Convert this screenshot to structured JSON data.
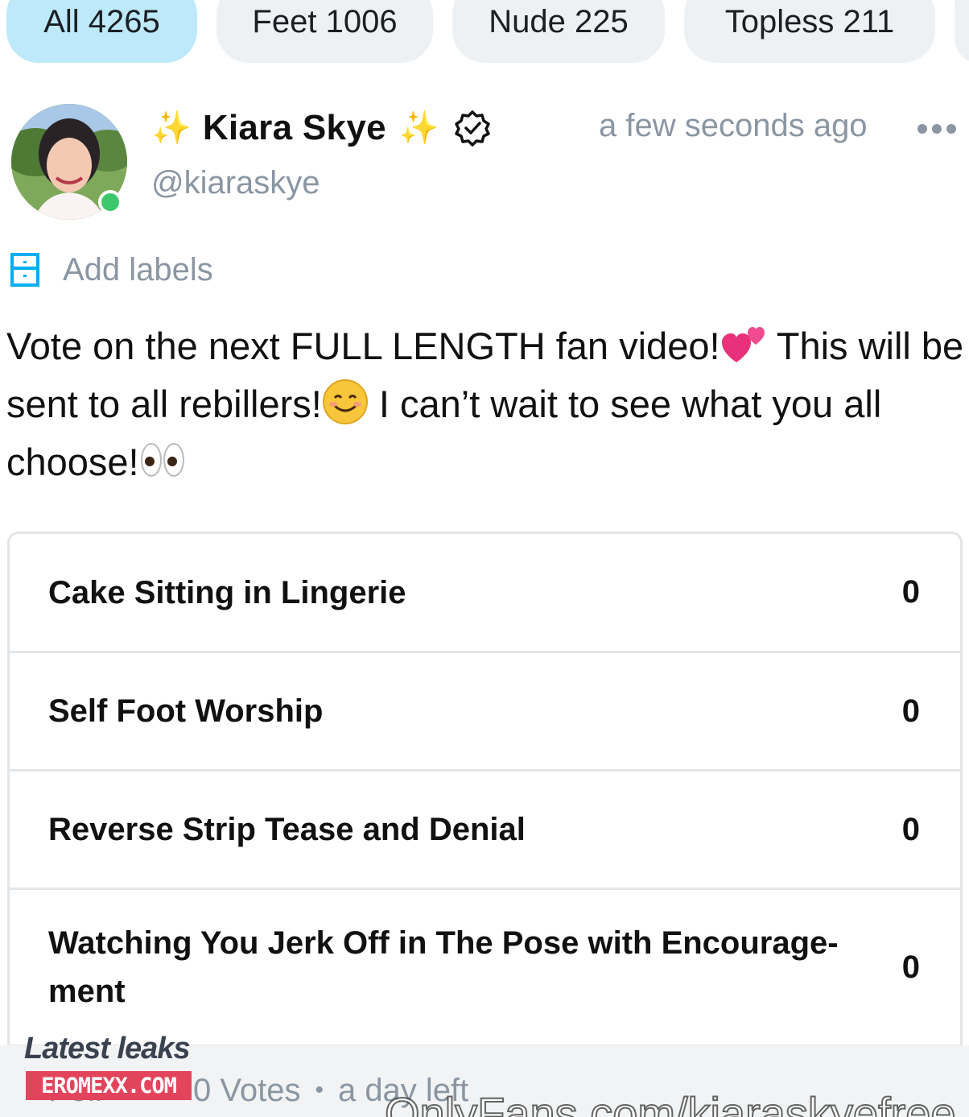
{
  "filters": [
    {
      "label": "All 4265",
      "active": true
    },
    {
      "label": "Feet 1006",
      "active": false
    },
    {
      "label": "Nude 225",
      "active": false
    },
    {
      "label": "Topless 211",
      "active": false
    }
  ],
  "post": {
    "author_name": "Kiara Skye",
    "sparkle_left": "✨",
    "sparkle_right": "✨",
    "handle": "@kiaraskye",
    "timestamp": "a few seconds ago",
    "add_labels": "Add labels",
    "text_1": "Vote on the next FULL LENGTH fan video!",
    "text_2": " This will be sent to all rebillers!",
    "text_3": " I can’t wait to see what you all choose!"
  },
  "poll": {
    "options": [
      {
        "label": "Cake Sitting in Lingerie",
        "count": "0"
      },
      {
        "label": "Self Foot Worship",
        "count": "0"
      },
      {
        "label": "Reverse Strip Tease and Denial",
        "count": "0"
      },
      {
        "label": "Watching You Jerk Off in The Pose with Encourage-ment",
        "count": "0"
      }
    ],
    "footer_stub": "Poll",
    "votes": "0 Votes",
    "separator": "•",
    "time_left": "a day left"
  },
  "watermark": {
    "latest": "Latest leaks",
    "site": "EROMEXX.COM",
    "url": "OnlyFans.com/kiaraskyefree"
  },
  "colors": {
    "active_chip": "#bde9fa",
    "chip": "#eef1f3",
    "muted_text": "#8a96a3",
    "online": "#3cc76b",
    "accent": "#00aff0"
  }
}
